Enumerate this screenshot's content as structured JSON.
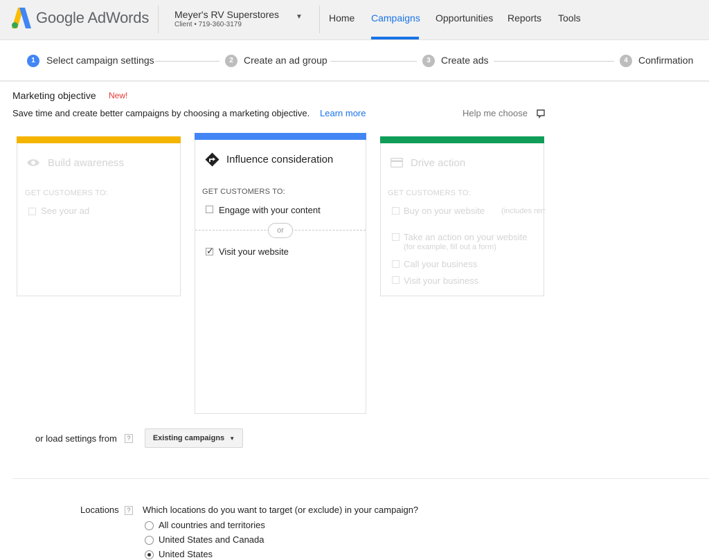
{
  "header": {
    "brand": "Google AdWords",
    "account_name": "Meyer's RV Superstores",
    "account_sub": "Client • 719-360-3179",
    "nav": [
      "Home",
      "Campaigns",
      "Opportunities",
      "Reports",
      "Tools"
    ],
    "active_nav": "Campaigns"
  },
  "steps": [
    {
      "num": "1",
      "label": "Select campaign settings",
      "active": true
    },
    {
      "num": "2",
      "label": "Create an ad group",
      "active": false
    },
    {
      "num": "3",
      "label": "Create ads",
      "active": false
    },
    {
      "num": "4",
      "label": "Confirmation",
      "active": false
    }
  ],
  "objective": {
    "title": "Marketing objective",
    "badge": "New!",
    "description": "Save time and create better campaigns by choosing a marketing objective.",
    "learn_more": "Learn more",
    "help": "Help me choose"
  },
  "cards": {
    "awareness": {
      "title": "Build awareness",
      "subtitle": "GET CUSTOMERS TO:",
      "options": [
        "See your ad"
      ],
      "color": "#f4b400"
    },
    "consideration": {
      "title": "Influence consideration",
      "subtitle": "GET CUSTOMERS TO:",
      "options": [
        "Engage with your content",
        "Visit your website"
      ],
      "separator": "or",
      "checked": "Visit your website",
      "color": "#4285f4"
    },
    "action": {
      "title": "Drive action",
      "subtitle": "GET CUSTOMERS TO:",
      "options": [
        "Buy on your website",
        "Take an action on your website",
        "Call your business",
        "Visit your business"
      ],
      "option_notes": [
        "(includes remarketing)",
        "(for example, fill out a form)"
      ],
      "color": "#0f9d58"
    }
  },
  "load_settings": {
    "label": "or load settings from",
    "help": "?",
    "button": "Existing campaigns"
  },
  "locations": {
    "label": "Locations",
    "help": "?",
    "question": "Which locations do you want to target (or exclude) in your campaign?",
    "options": [
      "All countries and territories",
      "United States and Canada",
      "United States"
    ],
    "selected": "United States"
  }
}
